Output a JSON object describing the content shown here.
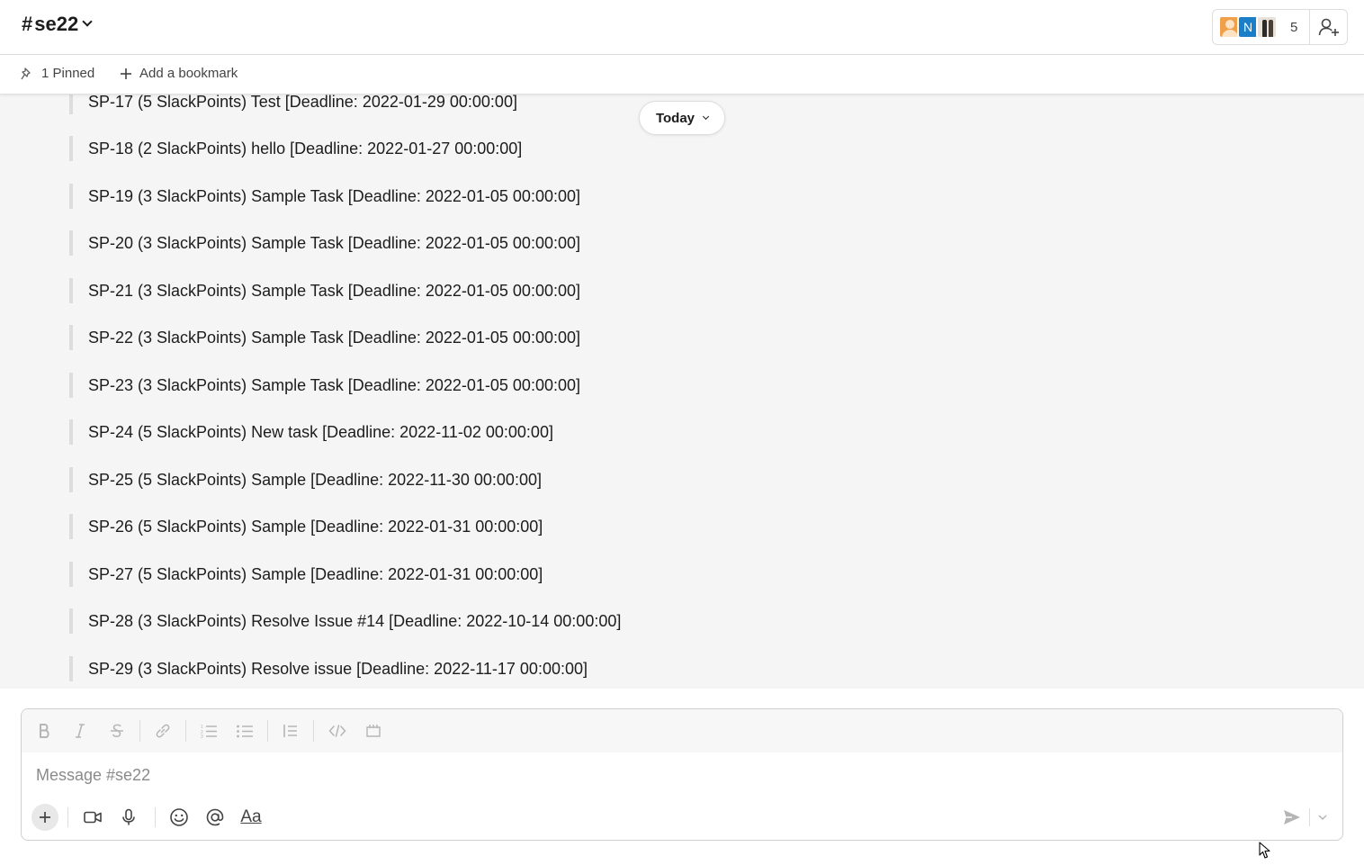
{
  "header": {
    "channel_hash": "#",
    "channel_name": "se22",
    "member_count": "5",
    "avatar_initial": "N"
  },
  "bookmarks": {
    "pinned_label": "1 Pinned",
    "add_label": "Add a bookmark"
  },
  "date_divider": {
    "label": "Today"
  },
  "messages": [
    "SP-17 (5 SlackPoints) Test [Deadline: 2022-01-29 00:00:00]",
    "SP-18 (2 SlackPoints) hello [Deadline: 2022-01-27 00:00:00]",
    "SP-19 (3 SlackPoints) Sample Task [Deadline: 2022-01-05 00:00:00]",
    "SP-20 (3 SlackPoints) Sample Task [Deadline: 2022-01-05 00:00:00]",
    "SP-21 (3 SlackPoints) Sample Task [Deadline: 2022-01-05 00:00:00]",
    "SP-22 (3 SlackPoints) Sample Task [Deadline: 2022-01-05 00:00:00]",
    "SP-23 (3 SlackPoints) Sample Task [Deadline: 2022-01-05 00:00:00]",
    "SP-24 (5 SlackPoints) New task [Deadline: 2022-11-02 00:00:00]",
    "SP-25 (5 SlackPoints) Sample [Deadline: 2022-11-30 00:00:00]",
    "SP-26 (5 SlackPoints) Sample [Deadline: 2022-01-31 00:00:00]",
    "SP-27 (5 SlackPoints) Sample [Deadline: 2022-01-31 00:00:00]",
    "SP-28 (3 SlackPoints) Resolve Issue #14 [Deadline: 2022-10-14 00:00:00]",
    "SP-29 (3 SlackPoints) Resolve issue [Deadline: 2022-11-17 00:00:00]"
  ],
  "composer": {
    "placeholder": "Message #se22",
    "format_label": "Aa"
  },
  "colors": {
    "avatar_orange": "#f0a04b",
    "avatar_blue": "#1a7fc8",
    "message_bg": "#f5f5f5",
    "quote_bar": "#dddddd"
  },
  "icons": {
    "format_bar": [
      "bold-icon",
      "italic-icon",
      "strikethrough-icon",
      "link-icon",
      "ordered-list-icon",
      "bulleted-list-icon",
      "blockquote-icon",
      "code-icon",
      "code-block-icon"
    ],
    "actions": [
      "plus-icon",
      "video-icon",
      "microphone-icon",
      "emoji-icon",
      "mention-icon",
      "format-text-icon"
    ],
    "send": [
      "send-icon",
      "chevron-down-icon"
    ]
  }
}
